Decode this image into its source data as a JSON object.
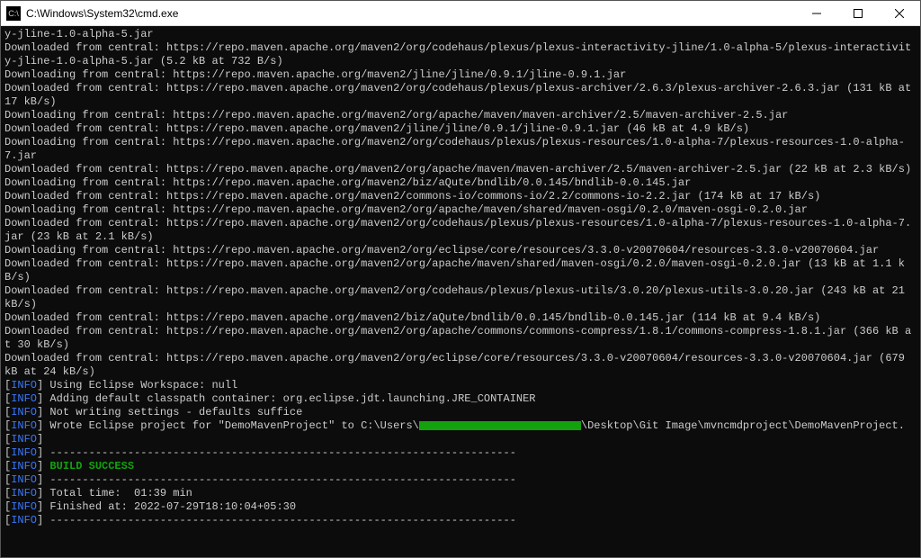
{
  "window": {
    "title": "C:\\Windows\\System32\\cmd.exe"
  },
  "terminal": {
    "lines": [
      {
        "t": "plain",
        "text": "y-jline-1.0-alpha-5.jar"
      },
      {
        "t": "plain",
        "text": "Downloaded from central: https://repo.maven.apache.org/maven2/org/codehaus/plexus/plexus-interactivity-jline/1.0-alpha-5/plexus-interactivity-jline-1.0-alpha-5.jar (5.2 kB at 732 B/s)"
      },
      {
        "t": "plain",
        "text": "Downloading from central: https://repo.maven.apache.org/maven2/jline/jline/0.9.1/jline-0.9.1.jar"
      },
      {
        "t": "plain",
        "text": "Downloaded from central: https://repo.maven.apache.org/maven2/org/codehaus/plexus/plexus-archiver/2.6.3/plexus-archiver-2.6.3.jar (131 kB at 17 kB/s)"
      },
      {
        "t": "plain",
        "text": "Downloading from central: https://repo.maven.apache.org/maven2/org/apache/maven/maven-archiver/2.5/maven-archiver-2.5.jar"
      },
      {
        "t": "plain",
        "text": "Downloaded from central: https://repo.maven.apache.org/maven2/jline/jline/0.9.1/jline-0.9.1.jar (46 kB at 4.9 kB/s)"
      },
      {
        "t": "plain",
        "text": "Downloading from central: https://repo.maven.apache.org/maven2/org/codehaus/plexus/plexus-resources/1.0-alpha-7/plexus-resources-1.0-alpha-7.jar"
      },
      {
        "t": "plain",
        "text": "Downloaded from central: https://repo.maven.apache.org/maven2/org/apache/maven/maven-archiver/2.5/maven-archiver-2.5.jar (22 kB at 2.3 kB/s)"
      },
      {
        "t": "plain",
        "text": "Downloading from central: https://repo.maven.apache.org/maven2/biz/aQute/bndlib/0.0.145/bndlib-0.0.145.jar"
      },
      {
        "t": "plain",
        "text": "Downloaded from central: https://repo.maven.apache.org/maven2/commons-io/commons-io/2.2/commons-io-2.2.jar (174 kB at 17 kB/s)"
      },
      {
        "t": "plain",
        "text": "Downloading from central: https://repo.maven.apache.org/maven2/org/apache/maven/shared/maven-osgi/0.2.0/maven-osgi-0.2.0.jar"
      },
      {
        "t": "plain",
        "text": "Downloaded from central: https://repo.maven.apache.org/maven2/org/codehaus/plexus/plexus-resources/1.0-alpha-7/plexus-resources-1.0-alpha-7.jar (23 kB at 2.1 kB/s)"
      },
      {
        "t": "plain",
        "text": "Downloading from central: https://repo.maven.apache.org/maven2/org/eclipse/core/resources/3.3.0-v20070604/resources-3.3.0-v20070604.jar"
      },
      {
        "t": "plain",
        "text": "Downloaded from central: https://repo.maven.apache.org/maven2/org/apache/maven/shared/maven-osgi/0.2.0/maven-osgi-0.2.0.jar (13 kB at 1.1 kB/s)"
      },
      {
        "t": "plain",
        "text": "Downloaded from central: https://repo.maven.apache.org/maven2/org/codehaus/plexus/plexus-utils/3.0.20/plexus-utils-3.0.20.jar (243 kB at 21 kB/s)"
      },
      {
        "t": "plain",
        "text": "Downloaded from central: https://repo.maven.apache.org/maven2/biz/aQute/bndlib/0.0.145/bndlib-0.0.145.jar (114 kB at 9.4 kB/s)"
      },
      {
        "t": "plain",
        "text": "Downloaded from central: https://repo.maven.apache.org/maven2/org/apache/commons/commons-compress/1.8.1/commons-compress-1.8.1.jar (366 kB at 30 kB/s)"
      },
      {
        "t": "plain",
        "text": "Downloaded from central: https://repo.maven.apache.org/maven2/org/eclipse/core/resources/3.3.0-v20070604/resources-3.3.0-v20070604.jar (679 kB at 24 kB/s)"
      },
      {
        "t": "info",
        "text": "Using Eclipse Workspace: null"
      },
      {
        "t": "info",
        "text": "Adding default classpath container: org.eclipse.jdt.launching.JRE_CONTAINER"
      },
      {
        "t": "info",
        "text": "Not writing settings - defaults suffice"
      },
      {
        "t": "info-redact",
        "pre": "Wrote Eclipse project for \"DemoMavenProject\" to C:\\Users\\",
        "post": "\\Desktop\\Git Image\\mvncmdproject\\DemoMavenProject."
      },
      {
        "t": "info",
        "text": ""
      },
      {
        "t": "info",
        "text": "------------------------------------------------------------------------"
      },
      {
        "t": "info-success",
        "text": "BUILD SUCCESS"
      },
      {
        "t": "info",
        "text": "------------------------------------------------------------------------"
      },
      {
        "t": "info",
        "text": "Total time:  01:39 min"
      },
      {
        "t": "info",
        "text": "Finished at: 2022-07-29T18:10:04+05:30"
      },
      {
        "t": "info",
        "text": "------------------------------------------------------------------------"
      }
    ],
    "info_tag": "INFO"
  }
}
